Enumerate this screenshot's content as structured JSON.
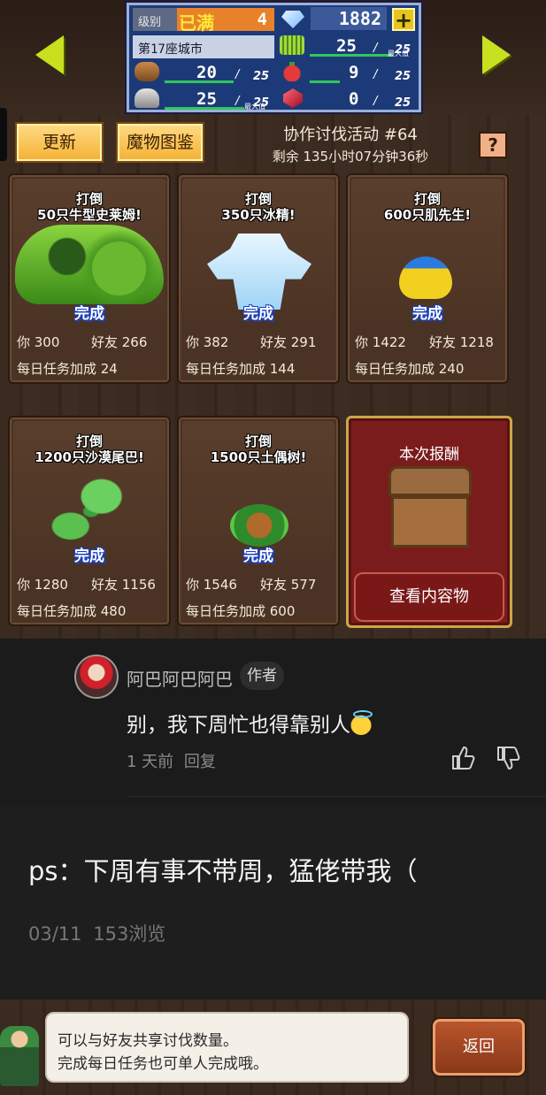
{
  "status": {
    "level_label": "级别",
    "level_full": "已满",
    "level_value": "4",
    "gems": "1882",
    "city": "第17座城市",
    "grass": {
      "value": "25",
      "max": "25",
      "tag": "最大值"
    },
    "wood": {
      "value": "20",
      "max": "25"
    },
    "fruit": {
      "value": "9",
      "max": "25"
    },
    "ore": {
      "value": "25",
      "max": "25",
      "tag": "最大值"
    },
    "ruby": {
      "value": "0",
      "max": "25"
    }
  },
  "toolbar": {
    "refresh_label": "更新",
    "dex_label": "魔物图鉴",
    "help_label": "?"
  },
  "event": {
    "title": "协作讨伐活动 #64",
    "remaining": "剩余 135小时07分钟36秒"
  },
  "cards": [
    {
      "line1": "打倒",
      "line2": "50只牛型史莱姆!",
      "status": "完成",
      "you": "你 300",
      "friend": "好友 266",
      "bonus": "每日任务加成 24",
      "monster": "slime"
    },
    {
      "line1": "打倒",
      "line2": "350只冰精!",
      "status": "完成",
      "you": "你 382",
      "friend": "好友 291",
      "bonus": "每日任务加成 144",
      "monster": "ice-spirit"
    },
    {
      "line1": "打倒",
      "line2": "600只肌先生!",
      "status": "完成",
      "you": "你 1422",
      "friend": "好友 1218",
      "bonus": "每日任务加成 240",
      "monster": "muscle-bird"
    },
    {
      "line1": "打倒",
      "line2": "1200只沙漠尾巴!",
      "status": "完成",
      "you": "你 1280",
      "friend": "好友 1156",
      "bonus": "每日任务加成 480",
      "monster": "desert-tail"
    },
    {
      "line1": "打倒",
      "line2": "1500只土偶树!",
      "status": "完成",
      "you": "你 1546",
      "friend": "好友 577",
      "bonus": "每日任务加成 600",
      "monster": "clay-tree"
    }
  ],
  "reward": {
    "title": "本次报酬",
    "view_label": "查看内容物"
  },
  "comment": {
    "author": "阿巴阿巴阿巴",
    "badge": "作者",
    "text": "别，我下周忙也得靠别人",
    "emoji": "angel-smile-emoji",
    "time": "1 天前",
    "reply_label": "回复"
  },
  "post": {
    "text": "ps：下周有事不带周，猛佬带我（",
    "date": "03/11",
    "views": "153浏览"
  },
  "bottom": {
    "tip_line1": "可以与好友共享讨伐数量。",
    "tip_line2": "完成每日任务也可单人完成哦。",
    "back_label": "返回"
  }
}
